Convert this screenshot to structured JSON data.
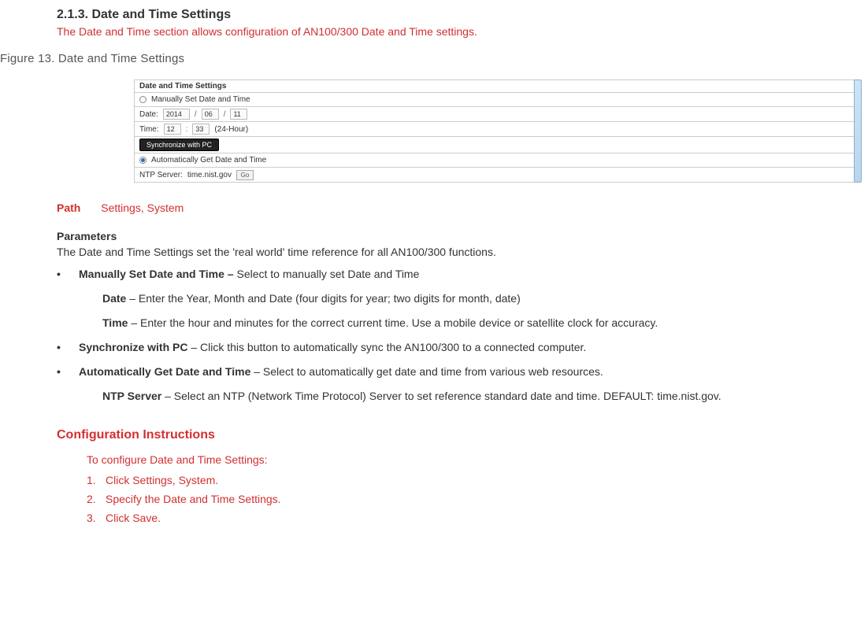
{
  "section": {
    "number_title": "2.1.3. Date and Time Settings",
    "subtitle": "The Date and Time section allows configuration of AN100/300 Date and Time settings."
  },
  "figure": {
    "caption": "Figure 13. Date and Time Settings",
    "panel_title": "Date and Time Settings",
    "radio_manual": "Manually Set Date and Time",
    "date_label": "Date:",
    "date_year": "2014",
    "date_month": "06",
    "date_day": "11",
    "slash": "/",
    "time_label": "Time:",
    "time_hour": "12",
    "time_colon": ":",
    "time_min": "33",
    "time_format": "(24-Hour)",
    "sync_button": "Synchronize with PC",
    "radio_auto": "Automatically Get Date and Time",
    "ntp_label": "NTP Server:",
    "ntp_value": "time.nist.gov",
    "go_label": "Go"
  },
  "path": {
    "label": "Path",
    "value": "Settings, System"
  },
  "parameters": {
    "heading": "Parameters",
    "intro": "The Date and Time Settings set the 'real world' time reference for all AN100/300 functions.",
    "manual": {
      "title": "Manually Set Date and Time – ",
      "desc": "Select to manually set Date and Time",
      "date_label": "Date",
      "date_desc": " – Enter the Year, Month and Date (four digits for year; two digits for month, date)",
      "time_label": "Time",
      "time_desc": " – Enter the hour and minutes for the correct current time. Use a mobile device or satellite clock for accuracy."
    },
    "sync": {
      "title": "Synchronize with PC",
      "desc": " – Click this button to automatically sync the AN100/300 to a connected computer."
    },
    "auto": {
      "title": "Automatically Get Date and Time",
      "desc": " – Select to automatically get date and time from various web resources.",
      "ntp_label": "NTP Server",
      "ntp_desc": " – Select an NTP (Network Time Protocol) Server to set reference standard date and time. DEFAULT: time.nist.gov."
    }
  },
  "config": {
    "heading": "Configuration Instructions",
    "intro": "To configure Date and Time Settings:",
    "steps": [
      {
        "n": "1.",
        "t": "Click Settings, System."
      },
      {
        "n": "2.",
        "t": "Specify the Date and Time Settings."
      },
      {
        "n": "3.",
        "t": "Click Save."
      }
    ]
  }
}
